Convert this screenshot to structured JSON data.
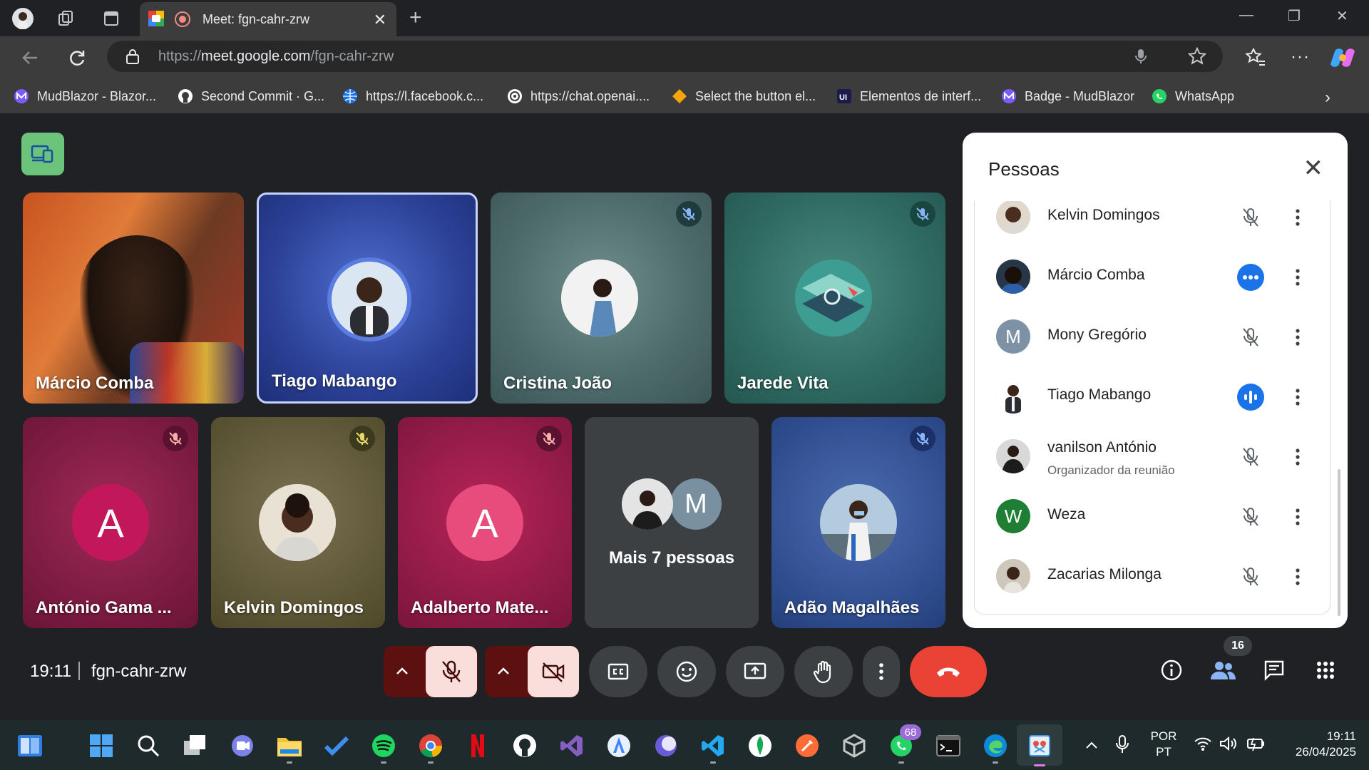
{
  "browser": {
    "tab_title": "Meet: fgn-cahr-zrw",
    "url_prefix": "https://",
    "url_host": "meet.google.com",
    "url_path": "/fgn-cahr-zrw",
    "bookmarks": [
      "MudBlazor - Blazor...",
      "Second Commit · G...",
      "https://l.facebook.c...",
      "https://chat.openai....",
      "Select the button el...",
      "Elementos de interf...",
      "Badge - MudBlazor",
      "WhatsApp"
    ]
  },
  "tiles": [
    {
      "name": "Márcio Comba"
    },
    {
      "name": "Tiago Mabango"
    },
    {
      "name": "Cristina João"
    },
    {
      "name": "Jarede Vita"
    },
    {
      "name": "António Gama ...",
      "letter": "A"
    },
    {
      "name": "Kelvin Domingos"
    },
    {
      "name": "Adalberto Mate...",
      "letter": "A"
    },
    {
      "name": "Mais 7 pessoas",
      "letter": "M"
    },
    {
      "name": "Adão Magalhães"
    }
  ],
  "panel": {
    "title": "Pessoas",
    "people": [
      {
        "name": "Kelvin Domingos",
        "sub": "",
        "letter": "",
        "status": "muted"
      },
      {
        "name": "Márcio Comba",
        "sub": "",
        "letter": "",
        "status": "speaking-dots"
      },
      {
        "name": "Mony Gregório",
        "sub": "",
        "letter": "M",
        "status": "muted"
      },
      {
        "name": "Tiago Mabango",
        "sub": "",
        "letter": "",
        "status": "speaking"
      },
      {
        "name": "vanilson António",
        "sub": "Organizador da reunião",
        "letter": "",
        "status": "muted"
      },
      {
        "name": "Weza",
        "sub": "",
        "letter": "W",
        "status": "muted"
      },
      {
        "name": "Zacarias Milonga",
        "sub": "",
        "letter": "",
        "status": "muted"
      }
    ]
  },
  "meeting": {
    "time": "19:11",
    "code": "fgn-cahr-zrw",
    "participant_count": "16"
  },
  "taskbar": {
    "lang": "POR",
    "region": "PT",
    "time": "19:11",
    "date": "26/04/2025",
    "whatsapp_badge": "68"
  },
  "colors": {
    "accent_blue": "#1a73e8",
    "end_call_red": "#ea4335",
    "muted_tile_pink": "#c2185b",
    "cast_green": "#6cc47a"
  }
}
